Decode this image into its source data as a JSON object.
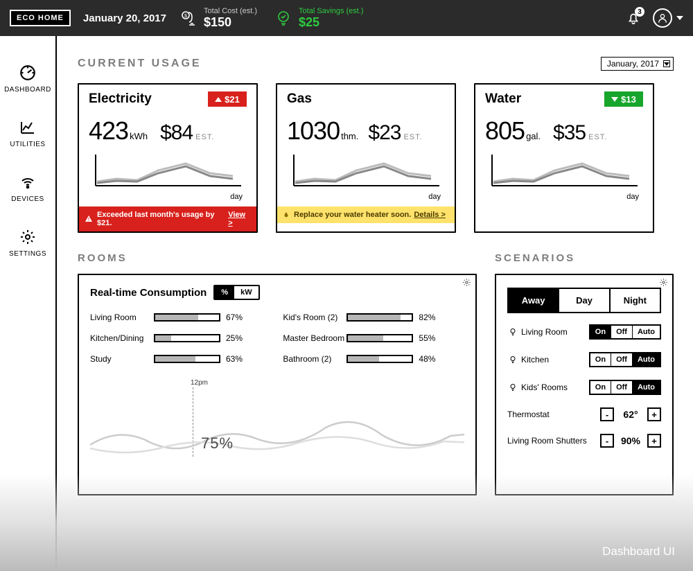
{
  "header": {
    "logo": "ECO HOME",
    "date": "January 20, 2017",
    "cost_label": "Total Cost (est.)",
    "cost_value": "$150",
    "savings_label": "Total Savings (est.)",
    "savings_value": "$25",
    "notifications": "3"
  },
  "sidebar": {
    "items": [
      {
        "label": "DASHBOARD"
      },
      {
        "label": "UTILITIES"
      },
      {
        "label": "DEVICES"
      },
      {
        "label": "SETTINGS"
      }
    ]
  },
  "usage": {
    "title": "CURRENT USAGE",
    "month_selector": "January, 2017",
    "cards": {
      "electricity": {
        "title": "Electricity",
        "delta": "$21",
        "delta_dir": "up",
        "amount": "423",
        "unit": "kWh",
        "cost": "$84",
        "est": "EST.",
        "axis": "day",
        "alert": "Exceeded last month's usage by $21.",
        "alert_link": "View >"
      },
      "gas": {
        "title": "Gas",
        "amount": "1030",
        "unit": "thm.",
        "cost": "$23",
        "est": "EST.",
        "axis": "day",
        "alert": "Replace your water heater soon.",
        "alert_link": "Details >"
      },
      "water": {
        "title": "Water",
        "delta": "$13",
        "delta_dir": "down",
        "amount": "805",
        "unit": "gal.",
        "cost": "$35",
        "est": "EST.",
        "axis": "day"
      }
    }
  },
  "rooms": {
    "title": "ROOMS",
    "panel_title": "Real-time Consumption",
    "toggle": {
      "a": "%",
      "b": "kW",
      "active": "a"
    },
    "items": [
      {
        "name": "Living Room",
        "pct": 67
      },
      {
        "name": "Kid's Room (2)",
        "pct": 82
      },
      {
        "name": "Kitchen/Dining",
        "pct": 25
      },
      {
        "name": "Master Bedroom",
        "pct": 55
      },
      {
        "name": "Study",
        "pct": 63
      },
      {
        "name": "Bathroom (2)",
        "pct": 48
      }
    ],
    "timeline": {
      "time": "12pm",
      "value": "75%"
    }
  },
  "scenarios": {
    "title": "SCENARIOS",
    "tabs": {
      "away": "Away",
      "day": "Day",
      "night": "Night",
      "active": "away"
    },
    "seg_labels": {
      "on": "On",
      "off": "Off",
      "auto": "Auto"
    },
    "rows": [
      {
        "name": "Living Room",
        "active": "on"
      },
      {
        "name": "Kitchen",
        "active": "auto"
      },
      {
        "name": "Kids' Rooms",
        "active": "auto"
      }
    ],
    "thermostat": {
      "label": "Thermostat",
      "value": "62°"
    },
    "shutters": {
      "label": "Living Room Shutters",
      "value": "90%"
    }
  },
  "footer_label": "Dashboard UI",
  "chart_data": {
    "type": "line",
    "title": "Usage trend per utility (sparkline)",
    "xlabel": "day",
    "series": [
      {
        "name": "Electricity",
        "values": [
          10,
          12,
          11,
          18,
          22,
          30,
          26,
          20
        ]
      },
      {
        "name": "Gas",
        "values": [
          9,
          10,
          10,
          17,
          21,
          29,
          24,
          18
        ]
      },
      {
        "name": "Water",
        "values": [
          11,
          12,
          12,
          19,
          23,
          31,
          25,
          19
        ]
      }
    ]
  }
}
